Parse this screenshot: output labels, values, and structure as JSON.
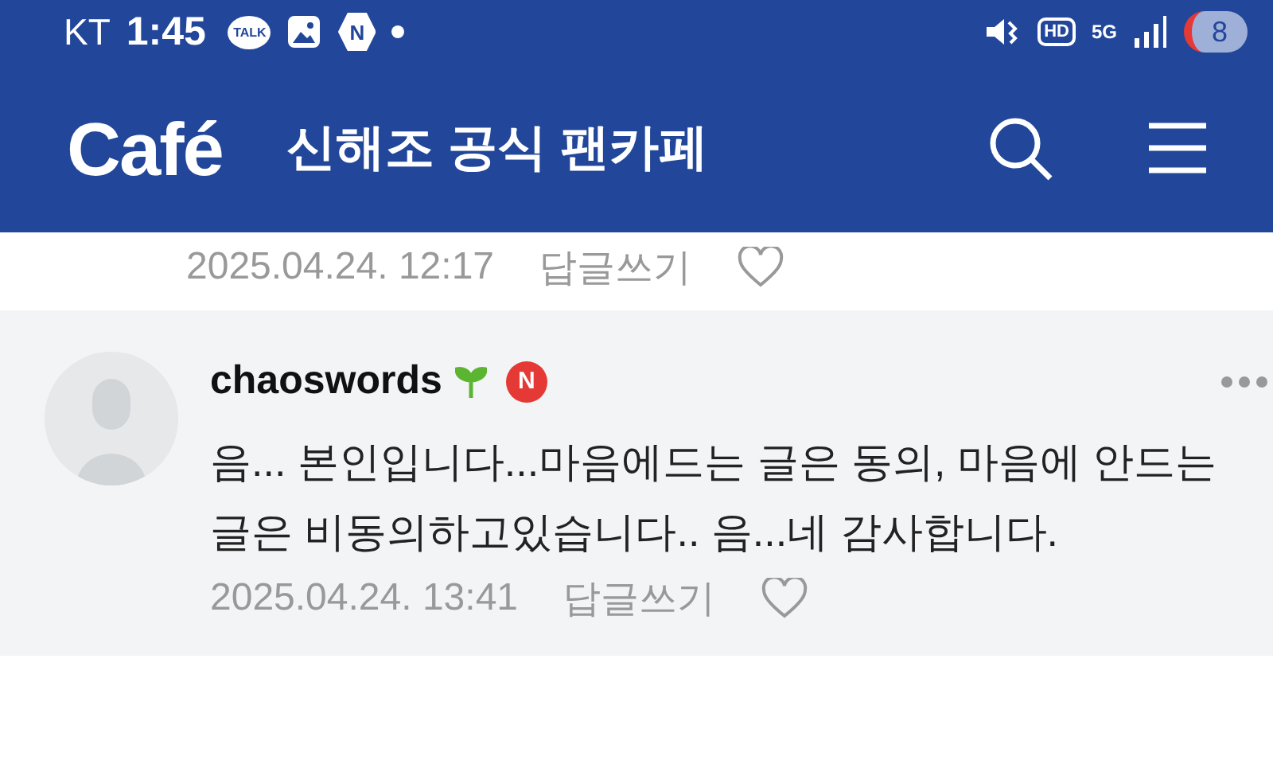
{
  "status_bar": {
    "carrier": "KT",
    "time": "1:45",
    "talk_label": "TALK",
    "n_label": "N",
    "hd_label": "HD",
    "net_label": "5G",
    "battery": "8"
  },
  "header": {
    "logo": "Café",
    "title": "신해조 공식 팬카페"
  },
  "comments": [
    {
      "kind": "clipped",
      "date": "2025.04.24. 12:17",
      "reply": "답글쓰기",
      "liked": false
    },
    {
      "kind": "full",
      "author": "chaoswords",
      "badge": "N",
      "body": "음... 본인입니다...마음에드는 글은 동의, 마음에 안드는 글은 비동의하고있습니다.. 음...네 감사합니다.",
      "date": "2025.04.24. 13:41",
      "reply": "답글쓰기",
      "liked": false
    }
  ]
}
